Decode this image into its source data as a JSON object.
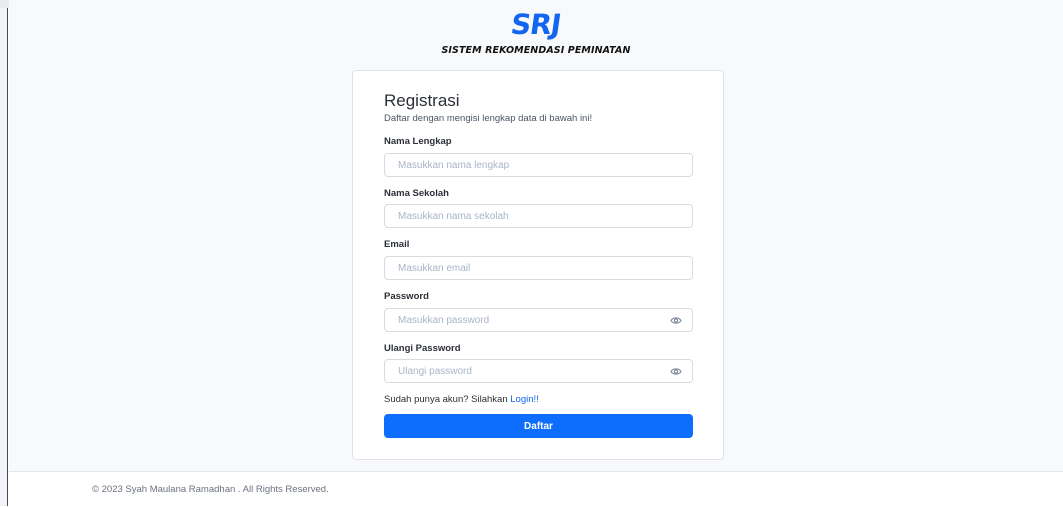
{
  "logo": {
    "mark": "SRJ",
    "tagline": "SISTEM REKOMENDASI PEMINATAN"
  },
  "form": {
    "title": "Registrasi",
    "subtitle": "Daftar dengan mengisi lengkap data di bawah ini!",
    "fields": [
      {
        "label": "Nama Lengkap",
        "placeholder": "Masukkan nama lengkap",
        "value": ""
      },
      {
        "label": "Nama Sekolah",
        "placeholder": "Masukkan nama sekolah",
        "value": ""
      },
      {
        "label": "Email",
        "placeholder": "Masukkan email",
        "value": ""
      },
      {
        "label": "Password",
        "placeholder": "Masukkan password",
        "value": "",
        "icon": "eye-icon"
      },
      {
        "label": "Ulangi Password",
        "placeholder": "Ulangi password",
        "value": "",
        "icon": "eye-icon"
      }
    ],
    "login_prompt": "Sudah punya akun? Silahkan",
    "login_link": "Login!!",
    "submit_label": "Daftar"
  },
  "footer": {
    "text": "© 2023 Syah Maulana Ramadhan . All Rights Reserved."
  },
  "colors": {
    "accent": "#0d6efd",
    "logo": "#1266f1",
    "background": "#f8f9fb"
  }
}
